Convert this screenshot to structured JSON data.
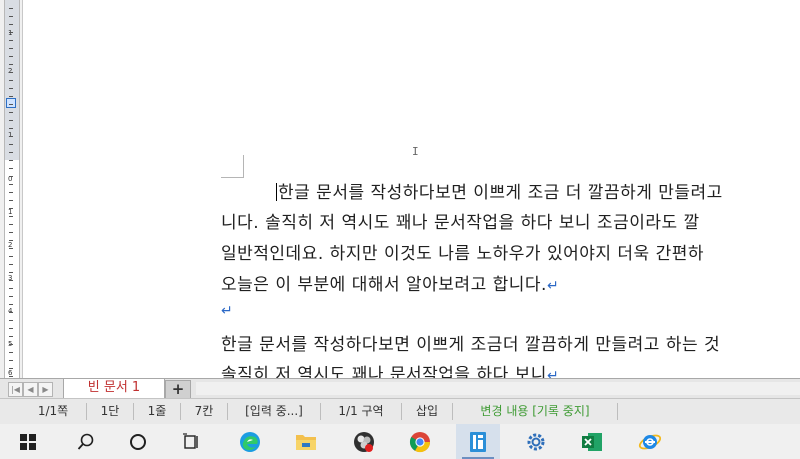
{
  "document": {
    "lines": [
      "한글 문서를 작성하다보면 이쁘게 조금 더 깔끔하게 만들려고",
      "니다. 솔직히 저 역시도 꽤나 문서작업을 하다 보니 조금이라도 깔",
      "일반적인데요. 하지만 이것도 나름 노하우가 있어야지 더욱 간편하",
      "오늘은 이 부분에 대해서 알아보려고 합니다.",
      "",
      "한글 문서를 작성하다보면 이쁘게 조금더 깔끔하게 만들려고 하는 것",
      "솔직히 저 역시도 꽤나 문서작업을 하다 보니"
    ],
    "paragraph_mark": "↵",
    "cursor_glyph": "I"
  },
  "ruler": {
    "numbers": [
      "1",
      "2",
      "1",
      "0",
      "1",
      "2",
      "3",
      "4",
      "5",
      "6"
    ]
  },
  "tabs": {
    "doc_tab_label": "빈 문서 1",
    "add_tab_label": "+",
    "nav_left": "◀",
    "nav_right": "▶"
  },
  "status": {
    "page": "1/1쪽",
    "column": "1단",
    "line": "1줄",
    "char": "7칸",
    "input_mode": "[입력 중...]",
    "section": "1/1 구역",
    "insert_mode": "삽입",
    "track_changes": "변경 내용 [기록 중지]"
  },
  "taskbar": {
    "icons": [
      "windows-start",
      "search",
      "cortana",
      "task-view",
      "edge",
      "file-explorer",
      "obs",
      "chrome",
      "hangul",
      "settings",
      "excel",
      "internet-explorer"
    ],
    "active": "hangul"
  },
  "colors": {
    "track_changes": "#3f9b34",
    "doc_tab_text": "#c03030",
    "paragraph_mark": "#2b68c6"
  }
}
